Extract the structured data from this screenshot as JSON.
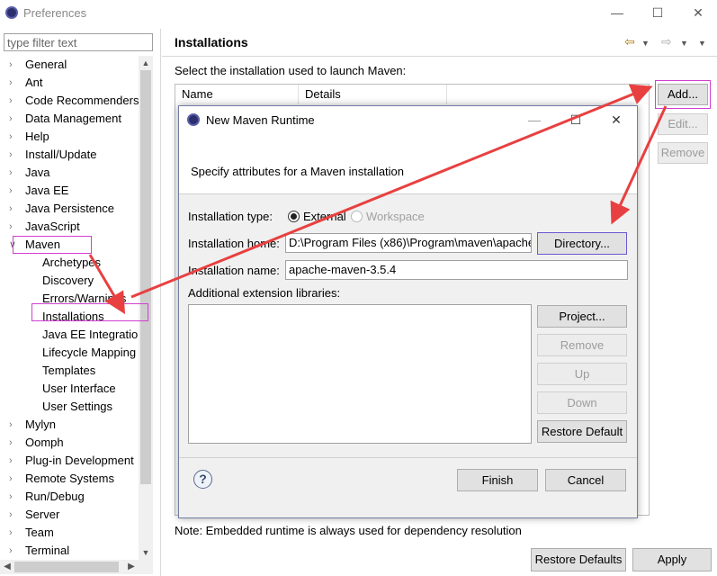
{
  "window": {
    "title": "Preferences",
    "minimize_glyph": "—",
    "maximize_glyph": "☐",
    "close_glyph": "✕"
  },
  "filter": {
    "placeholder": "type filter text"
  },
  "tree": {
    "items": [
      {
        "label": "General",
        "level": 0,
        "state": "collapsed"
      },
      {
        "label": "Ant",
        "level": 0,
        "state": "collapsed"
      },
      {
        "label": "Code Recommenders",
        "level": 0,
        "state": "collapsed"
      },
      {
        "label": "Data Management",
        "level": 0,
        "state": "collapsed"
      },
      {
        "label": "Help",
        "level": 0,
        "state": "collapsed"
      },
      {
        "label": "Install/Update",
        "level": 0,
        "state": "collapsed"
      },
      {
        "label": "Java",
        "level": 0,
        "state": "collapsed"
      },
      {
        "label": "Java EE",
        "level": 0,
        "state": "collapsed"
      },
      {
        "label": "Java Persistence",
        "level": 0,
        "state": "collapsed"
      },
      {
        "label": "JavaScript",
        "level": 0,
        "state": "collapsed"
      },
      {
        "label": "Maven",
        "level": 0,
        "state": "expanded"
      },
      {
        "label": "Archetypes",
        "level": 1,
        "state": "leaf"
      },
      {
        "label": "Discovery",
        "level": 1,
        "state": "leaf"
      },
      {
        "label": "Errors/Warnings",
        "level": 1,
        "state": "leaf"
      },
      {
        "label": "Installations",
        "level": 1,
        "state": "leaf"
      },
      {
        "label": "Java EE Integration",
        "level": 1,
        "state": "leaf"
      },
      {
        "label": "Lifecycle Mapping",
        "level": 1,
        "state": "leaf"
      },
      {
        "label": "Templates",
        "level": 1,
        "state": "leaf"
      },
      {
        "label": "User Interface",
        "level": 1,
        "state": "leaf"
      },
      {
        "label": "User Settings",
        "level": 1,
        "state": "leaf"
      },
      {
        "label": "Mylyn",
        "level": 0,
        "state": "collapsed"
      },
      {
        "label": "Oomph",
        "level": 0,
        "state": "collapsed"
      },
      {
        "label": "Plug-in Development",
        "level": 0,
        "state": "collapsed"
      },
      {
        "label": "Remote Systems",
        "level": 0,
        "state": "collapsed"
      },
      {
        "label": "Run/Debug",
        "level": 0,
        "state": "collapsed"
      },
      {
        "label": "Server",
        "level": 0,
        "state": "collapsed"
      },
      {
        "label": "Team",
        "level": 0,
        "state": "collapsed"
      },
      {
        "label": "Terminal",
        "level": 0,
        "state": "collapsed"
      }
    ]
  },
  "page": {
    "title": "Installations",
    "select_label": "Select the installation used to launch Maven:",
    "table_headers": [
      "Name",
      "Details"
    ],
    "add_button": "Add...",
    "edit_button": "Edit...",
    "remove_button": "Remove",
    "note": "Note: Embedded runtime is always used for dependency resolution",
    "restore_defaults_button": "Restore Defaults",
    "apply_button": "Apply"
  },
  "dialog": {
    "title": "New Maven Runtime",
    "description": "Specify attributes for a Maven installation",
    "installation_type_label": "Installation type:",
    "radio_external": "External",
    "radio_workspace": "Workspace",
    "installation_home_label": "Installation home:",
    "installation_home_value": "D:\\Program Files (x86)\\Program\\maven\\apache",
    "directory_button": "Directory...",
    "installation_name_label": "Installation name:",
    "installation_name_value": "apache-maven-3.5.4",
    "ext_libs_label": "Additional extension libraries:",
    "project_button": "Project...",
    "remove_button": "Remove",
    "up_button": "Up",
    "down_button": "Down",
    "restore_default_button": "Restore Default",
    "finish_button": "Finish",
    "cancel_button": "Cancel",
    "help_glyph": "?"
  },
  "colors": {
    "annotation_arrow": "#e84040",
    "highlight_box": "#d040d0",
    "directory_focus": "#6a5ad0"
  }
}
